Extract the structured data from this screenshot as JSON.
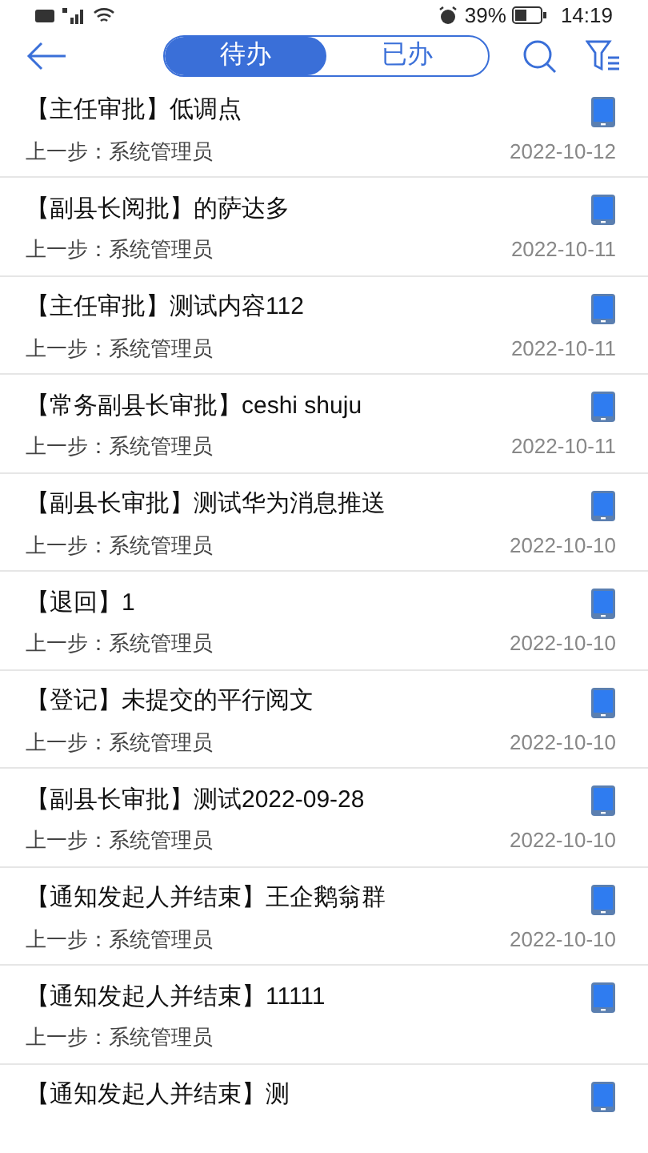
{
  "status_bar": {
    "battery_percent": "39%",
    "time": "14:19"
  },
  "tabs": [
    {
      "label": "待办",
      "selected": true
    },
    {
      "label": "已办",
      "selected": false
    }
  ],
  "items": [
    {
      "title": "【主任审批】低调点",
      "previous_step": "上一步：系统管理员",
      "date": "2022-10-12"
    },
    {
      "title": "【副县长阅批】的萨达多",
      "previous_step": "上一步：系统管理员",
      "date": "2022-10-11"
    },
    {
      "title": "【主任审批】测试内容112",
      "previous_step": "上一步：系统管理员",
      "date": "2022-10-11"
    },
    {
      "title": "【常务副县长审批】ceshi shuju",
      "previous_step": "上一步：系统管理员",
      "date": "2022-10-11"
    },
    {
      "title": "【副县长审批】测试华为消息推送",
      "previous_step": "上一步：系统管理员",
      "date": "2022-10-10"
    },
    {
      "title": "【退回】1",
      "previous_step": "上一步：系统管理员",
      "date": "2022-10-10"
    },
    {
      "title": "【登记】未提交的平行阅文",
      "previous_step": "上一步：系统管理员",
      "date": "2022-10-10"
    },
    {
      "title": "【副县长审批】测试2022-09-28",
      "previous_step": "上一步：系统管理员",
      "date": "2022-10-10"
    },
    {
      "title": "【通知发起人并结束】王企鹅翁群",
      "previous_step": "上一步：系统管理员",
      "date": "2022-10-10"
    },
    {
      "title": "【通知发起人并结束】11111",
      "previous_step": "上一步：系统管理员"
    },
    {
      "title": "【通知发起人并结束】测"
    }
  ]
}
